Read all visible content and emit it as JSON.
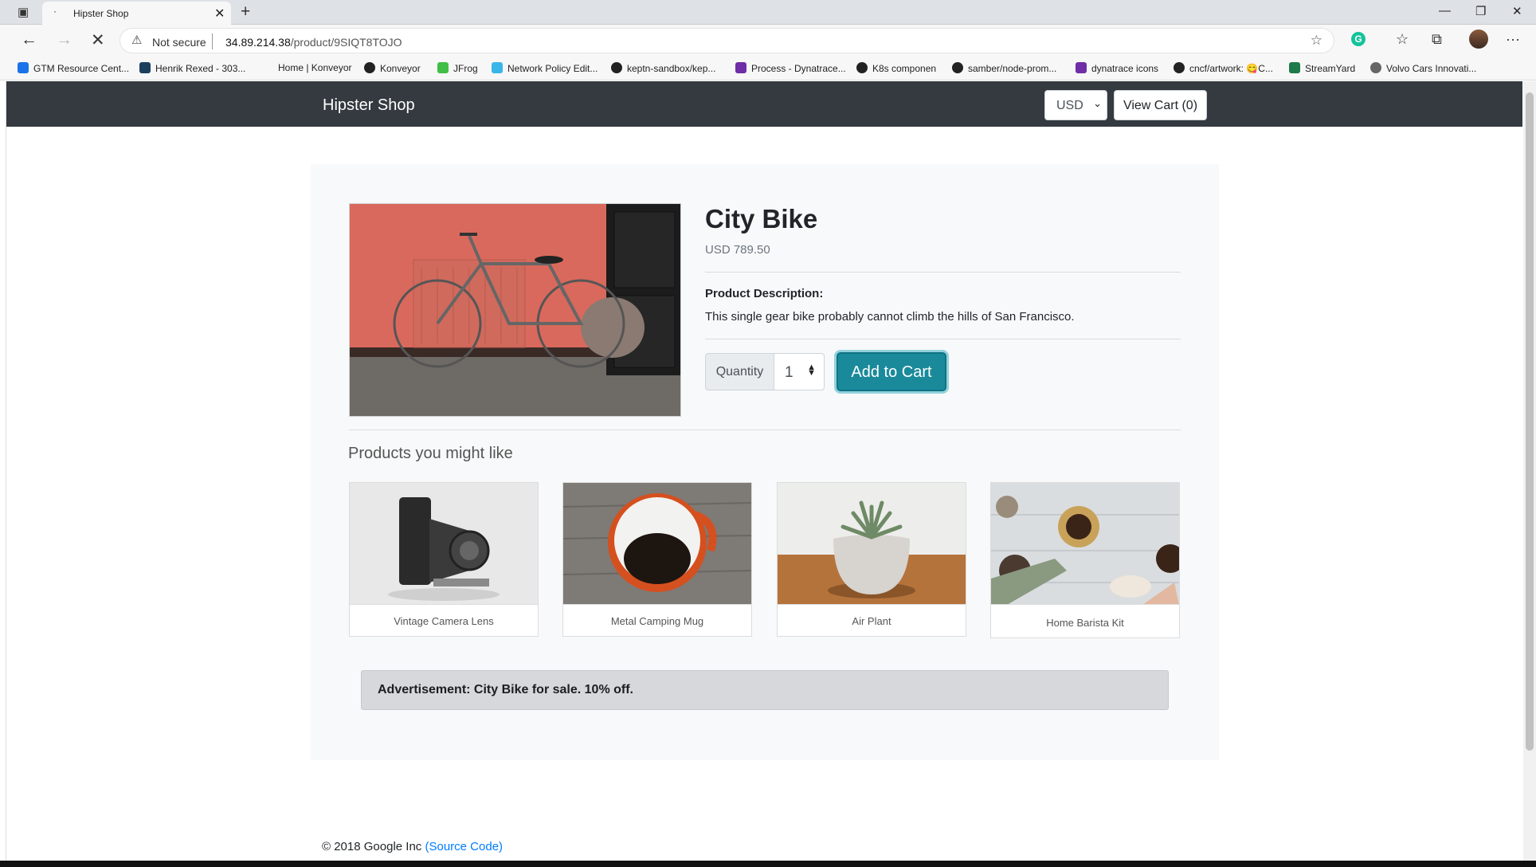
{
  "browser": {
    "tab_title": "Hipster Shop",
    "tab_favicon": "·",
    "url_warning": "Not secure",
    "url_host": "34.89.214.38",
    "url_path": "/product/9SIQT8TOJO"
  },
  "bookmarks": [
    "GTM Resource Cent...",
    "Henrik Rexed - 303...",
    "Home | Konveyor",
    "Konveyor",
    "JFrog",
    "Network Policy Edit...",
    "keptn-sandbox/kep...",
    "Process - Dynatrace...",
    "K8s componen",
    "samber/node-prom...",
    "dynatrace icons",
    "cncf/artwork: 😋C...",
    "StreamYard",
    "Volvo Cars Innovati..."
  ],
  "navbar": {
    "brand": "Hipster Shop",
    "currency": "USD",
    "view_cart": "View Cart (0)"
  },
  "product": {
    "name": "City Bike",
    "price": "USD 789.50",
    "description_label": "Product Description:",
    "description": "This single gear bike probably cannot climb the hills of San Francisco.",
    "quantity_label": "Quantity",
    "quantity_value": "1",
    "add_to_cart": "Add to Cart"
  },
  "recommendations": {
    "heading": "Products you might like",
    "items": [
      {
        "name": "Vintage Camera Lens"
      },
      {
        "name": "Metal Camping Mug"
      },
      {
        "name": "Air Plant"
      },
      {
        "name": "Home Barista Kit"
      }
    ]
  },
  "advertisement": "Advertisement: City Bike for sale. 10% off.",
  "footer": {
    "copyright": "© 2018 Google Inc",
    "source_link": "(Source Code)"
  },
  "colors": {
    "navbar_bg": "#343a40",
    "add_to_cart_bg": "#1a8a9b",
    "link": "#007bff"
  }
}
